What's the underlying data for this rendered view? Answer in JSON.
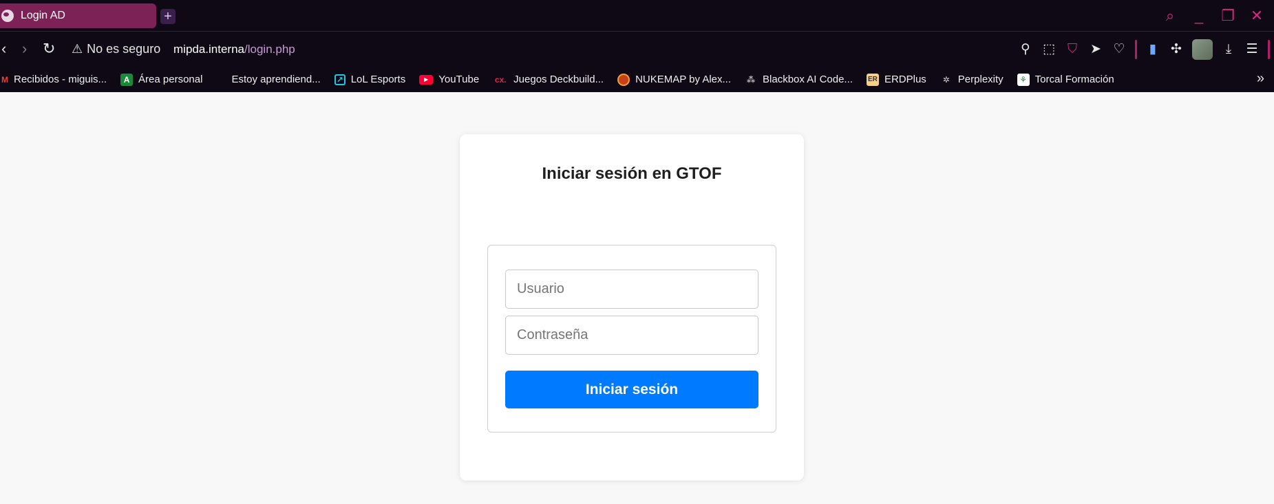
{
  "browser": {
    "tab": {
      "title": "Login AD",
      "new_tab_label": "+"
    },
    "window_controls": {
      "search": "⌕",
      "minimize": "_",
      "restore": "❐",
      "close": "✕"
    },
    "nav": {
      "back": "‹",
      "forward": "›",
      "reload": "↻"
    },
    "security_warning": {
      "icon": "⚠",
      "text": "No es seguro"
    },
    "url": {
      "host": "mipda.interna",
      "path": "/login.php"
    },
    "toolbar": {
      "pin": "⚲",
      "screenshot": "⬚",
      "pocket": "⛉",
      "send": "➤",
      "favorites": "♡",
      "note": "▮",
      "extensions": "✣",
      "downloads": "⤓",
      "menu": "☰"
    },
    "bookmarks": [
      {
        "icon": "M",
        "label": "Recibidos - miguis..."
      },
      {
        "icon": "A",
        "label": "Área personal"
      },
      {
        "icon": "",
        "label": "Estoy aprendiend..."
      },
      {
        "icon": "↗",
        "label": "LoL Esports"
      },
      {
        "icon": "▶",
        "label": "YouTube"
      },
      {
        "icon": "cx.",
        "label": "Juegos Deckbuild..."
      },
      {
        "icon": "◎",
        "label": "NUKEMAP by Alex..."
      },
      {
        "icon": "⁂",
        "label": "Blackbox AI Code..."
      },
      {
        "icon": "ER",
        "label": "ERDPlus"
      },
      {
        "icon": "✲",
        "label": "Perplexity"
      },
      {
        "icon": "⚘",
        "label": "Torcal Formación"
      }
    ],
    "more_bookmarks": "»",
    "colors": {
      "accent": "#d6277a",
      "tab_active": "#7c2256",
      "chrome_bg": "#0e0915"
    }
  },
  "login": {
    "title": "Iniciar sesión en GTOF",
    "username_placeholder": "Usuario",
    "password_placeholder": "Contraseña",
    "submit_label": "Iniciar sesión",
    "colors": {
      "button": "#007bff",
      "page_bg": "#f8f8f8"
    }
  }
}
